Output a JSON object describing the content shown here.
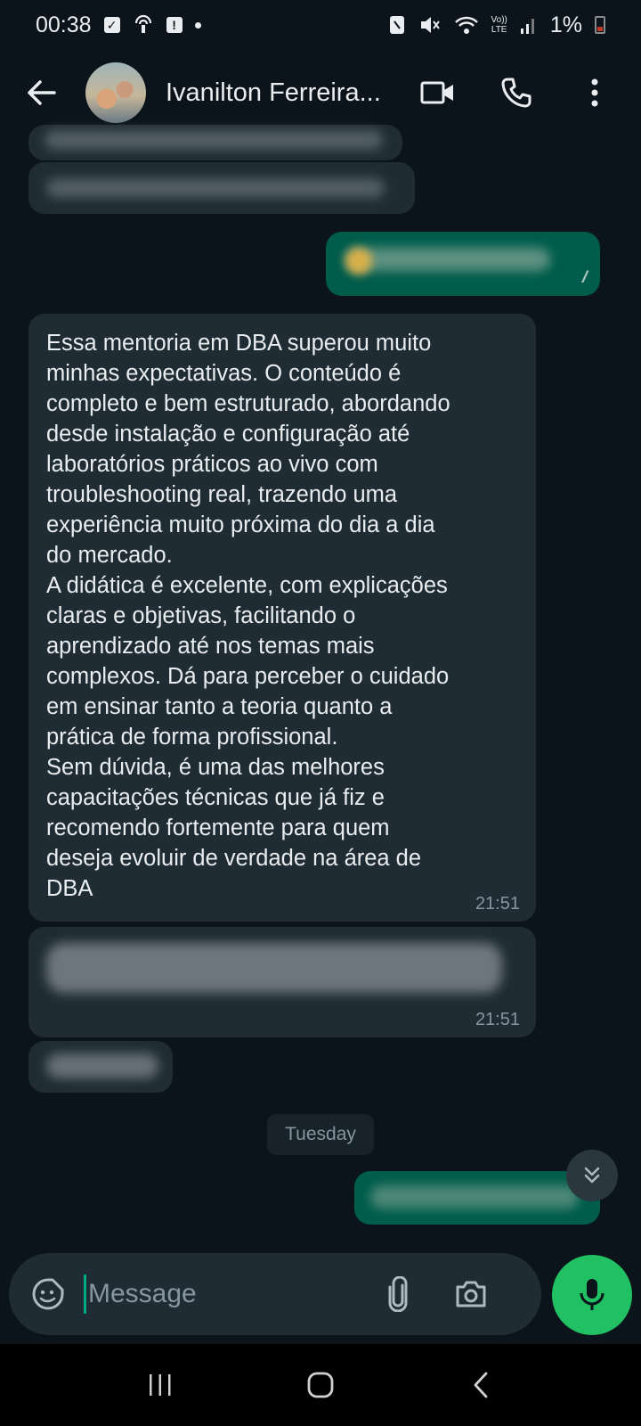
{
  "status_bar": {
    "time": "00:38",
    "battery": "1%",
    "network_label_top": "Vo))",
    "network_label_bottom": "LTE"
  },
  "header": {
    "contact_name": "Ivanilton Ferreira...",
    "icons": [
      "back-arrow-icon",
      "video-call-icon",
      "phone-icon",
      "more-vert-icon"
    ]
  },
  "messages": {
    "main": {
      "text": "Essa mentoria em DBA superou muito\nminhas expectativas. O conteúdo é\ncompleto e bem estruturado, abordando\ndesde instalação e configuração até\nlaboratórios práticos ao vivo com\ntroubleshooting real, trazendo uma\nexperiência muito próxima do dia a dia\ndo mercado.\nA didática é excelente, com explicações\nclaras e objetivas, facilitando o\naprendizado até nos temas mais\ncomplexos. Dá para perceber o cuidado\nem ensinar tanto a teoria quanto a\nprática de forma profissional.\nSem dúvida, é uma das melhores\ncapacitações técnicas que já fiz e\nrecomendo fortemente para quem\ndeseja evoluir de verdade na área de\nDBA",
      "time": "21:51"
    },
    "blurred_incoming_time": "21:51",
    "date_separator": "Tuesday"
  },
  "composer": {
    "placeholder": "Message"
  },
  "colors": {
    "background": "#0b141a",
    "incoming_bubble": "#202c33",
    "outgoing_bubble": "#005c4b",
    "mic_button": "#21c063"
  }
}
